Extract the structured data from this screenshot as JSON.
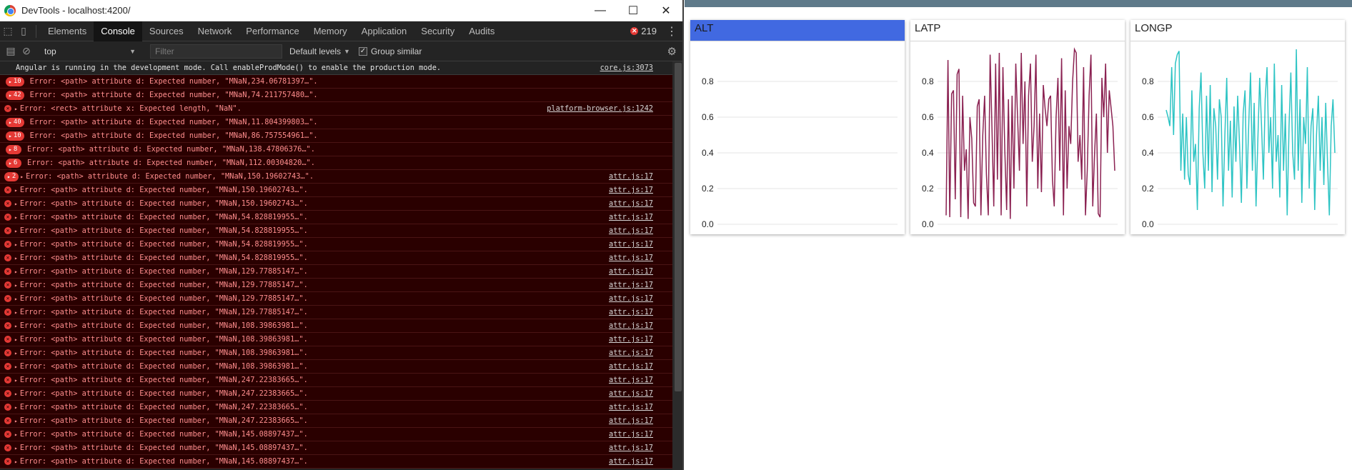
{
  "window": {
    "title": "DevTools - localhost:4200/"
  },
  "tabs": [
    "Elements",
    "Console",
    "Sources",
    "Network",
    "Performance",
    "Memory",
    "Application",
    "Security",
    "Audits"
  ],
  "active_tab": "Console",
  "error_count": "219",
  "toolbar": {
    "context": "top",
    "filter_placeholder": "Filter",
    "levels": "Default levels",
    "group_similar": "Group similar"
  },
  "console": [
    {
      "kind": "info",
      "text": "Angular is running in the development mode. Call enableProdMode() to enable the production mode.",
      "src": "core.js:3073"
    },
    {
      "kind": "badge",
      "count": "10",
      "text": "Error: <path> attribute d: Expected number, \"MNaN,234.06781397…\".",
      "src": ""
    },
    {
      "kind": "badge",
      "count": "42",
      "text": "Error: <path> attribute d: Expected number, \"MNaN,74.211757480…\".",
      "src": ""
    },
    {
      "kind": "error",
      "text": "Error: <rect> attribute x: Expected length, \"NaN\".",
      "src": "platform-browser.js:1242"
    },
    {
      "kind": "badge",
      "count": "40",
      "text": "Error: <path> attribute d: Expected number, \"MNaN,11.804399803…\".",
      "src": ""
    },
    {
      "kind": "badge",
      "count": "10",
      "text": "Error: <path> attribute d: Expected number, \"MNaN,86.757554961…\".",
      "src": ""
    },
    {
      "kind": "badge",
      "count": "8",
      "text": "Error: <path> attribute d: Expected number, \"MNaN,138.47806376…\".",
      "src": ""
    },
    {
      "kind": "badge",
      "count": "6",
      "text": "Error: <path> attribute d: Expected number, \"MNaN,112.00304820…\".",
      "src": ""
    },
    {
      "kind": "badge-small",
      "count": "2",
      "text": "Error: <path> attribute d: Expected number, \"MNaN,150.19602743…\".",
      "src": "attr.js:17"
    },
    {
      "kind": "error",
      "text": "Error: <path> attribute d: Expected number, \"MNaN,150.19602743…\".",
      "src": "attr.js:17"
    },
    {
      "kind": "error",
      "text": "Error: <path> attribute d: Expected number, \"MNaN,150.19602743…\".",
      "src": "attr.js:17"
    },
    {
      "kind": "error",
      "text": "Error: <path> attribute d: Expected number, \"MNaN,54.828819955…\".",
      "src": "attr.js:17"
    },
    {
      "kind": "error",
      "text": "Error: <path> attribute d: Expected number, \"MNaN,54.828819955…\".",
      "src": "attr.js:17"
    },
    {
      "kind": "error",
      "text": "Error: <path> attribute d: Expected number, \"MNaN,54.828819955…\".",
      "src": "attr.js:17"
    },
    {
      "kind": "error",
      "text": "Error: <path> attribute d: Expected number, \"MNaN,54.828819955…\".",
      "src": "attr.js:17"
    },
    {
      "kind": "error",
      "text": "Error: <path> attribute d: Expected number, \"MNaN,129.77885147…\".",
      "src": "attr.js:17"
    },
    {
      "kind": "error",
      "text": "Error: <path> attribute d: Expected number, \"MNaN,129.77885147…\".",
      "src": "attr.js:17"
    },
    {
      "kind": "error",
      "text": "Error: <path> attribute d: Expected number, \"MNaN,129.77885147…\".",
      "src": "attr.js:17"
    },
    {
      "kind": "error",
      "text": "Error: <path> attribute d: Expected number, \"MNaN,129.77885147…\".",
      "src": "attr.js:17"
    },
    {
      "kind": "error",
      "text": "Error: <path> attribute d: Expected number, \"MNaN,108.39863981…\".",
      "src": "attr.js:17"
    },
    {
      "kind": "error",
      "text": "Error: <path> attribute d: Expected number, \"MNaN,108.39863981…\".",
      "src": "attr.js:17"
    },
    {
      "kind": "error",
      "text": "Error: <path> attribute d: Expected number, \"MNaN,108.39863981…\".",
      "src": "attr.js:17"
    },
    {
      "kind": "error",
      "text": "Error: <path> attribute d: Expected number, \"MNaN,108.39863981…\".",
      "src": "attr.js:17"
    },
    {
      "kind": "error",
      "text": "Error: <path> attribute d: Expected number, \"MNaN,247.22383665…\".",
      "src": "attr.js:17"
    },
    {
      "kind": "error",
      "text": "Error: <path> attribute d: Expected number, \"MNaN,247.22383665…\".",
      "src": "attr.js:17"
    },
    {
      "kind": "error",
      "text": "Error: <path> attribute d: Expected number, \"MNaN,247.22383665…\".",
      "src": "attr.js:17"
    },
    {
      "kind": "error",
      "text": "Error: <path> attribute d: Expected number, \"MNaN,247.22383665…\".",
      "src": "attr.js:17"
    },
    {
      "kind": "error",
      "text": "Error: <path> attribute d: Expected number, \"MNaN,145.08897437…\".",
      "src": "attr.js:17"
    },
    {
      "kind": "error",
      "text": "Error: <path> attribute d: Expected number, \"MNaN,145.08897437…\".",
      "src": "attr.js:17"
    },
    {
      "kind": "error",
      "text": "Error: <path> attribute d: Expected number, \"MNaN,145.08897437…\".",
      "src": "attr.js:17"
    }
  ],
  "chart_data": [
    {
      "type": "line",
      "title": "ALT",
      "color": "#4169e1",
      "ylim": [
        0,
        1
      ],
      "yticks": [
        "0.0",
        "0.2",
        "0.4",
        "0.6",
        "0.8"
      ],
      "values": []
    },
    {
      "type": "line",
      "title": "LATP",
      "color": "#8b2252",
      "ylim": [
        0,
        1
      ],
      "yticks": [
        "0.0",
        "0.2",
        "0.4",
        "0.6",
        "0.8"
      ],
      "values": [
        0.05,
        0.92,
        0.04,
        0.73,
        0.75,
        0.14,
        0.84,
        0.87,
        0.04,
        0.72,
        0.3,
        0.42,
        0.03,
        0.6,
        0.48,
        0.12,
        0.1,
        0.66,
        0.7,
        0.05,
        0.5,
        0.72,
        0.28,
        0.05,
        0.95,
        0.55,
        0.1,
        0.9,
        0.25,
        0.96,
        0.05,
        0.88,
        0.42,
        0.08,
        0.7,
        0.03,
        0.72,
        0.2,
        0.9,
        0.6,
        0.3,
        0.96,
        0.45,
        0.8,
        0.1,
        0.72,
        0.9,
        0.35,
        0.55,
        0.95,
        0.2,
        0.62,
        0.18,
        0.78,
        0.65,
        0.55,
        0.7,
        0.72,
        0.25,
        0.1,
        0.6,
        0.82,
        0.3,
        0.93,
        0.05,
        0.75,
        0.2,
        0.55,
        0.45,
        0.8,
        0.98,
        0.96,
        0.35,
        0.5,
        0.25,
        0.88,
        0.05,
        0.3,
        0.72,
        0.95,
        0.1,
        0.4,
        0.62,
        0.06,
        0.04,
        0.82,
        0.6,
        0.9,
        0.4,
        0.75,
        0.65,
        0.55,
        0.3
      ]
    },
    {
      "type": "line",
      "title": "LONGP",
      "color": "#2ec4c4",
      "ylim": [
        0,
        1
      ],
      "yticks": [
        "0.0",
        "0.2",
        "0.4",
        "0.6",
        "0.8"
      ],
      "values": [
        0.64,
        0.6,
        0.55,
        0.88,
        0.5,
        0.9,
        0.95,
        0.97,
        0.3,
        0.62,
        0.25,
        0.6,
        0.28,
        0.22,
        0.75,
        0.35,
        0.45,
        0.08,
        0.65,
        0.85,
        0.4,
        0.2,
        0.72,
        0.3,
        0.78,
        0.18,
        0.65,
        0.55,
        0.25,
        0.7,
        0.6,
        0.1,
        0.5,
        0.82,
        0.3,
        0.58,
        0.15,
        0.66,
        0.35,
        0.72,
        0.45,
        0.12,
        0.62,
        0.75,
        0.2,
        0.55,
        0.85,
        0.3,
        0.68,
        0.1,
        0.48,
        0.82,
        0.55,
        0.25,
        0.7,
        0.88,
        0.4,
        0.6,
        0.2,
        0.9,
        0.35,
        0.5,
        0.15,
        0.78,
        0.3,
        0.62,
        0.05,
        0.55,
        0.85,
        0.4,
        0.25,
        0.98,
        0.3,
        0.7,
        0.12,
        0.6,
        0.45,
        0.88,
        0.2,
        0.55,
        0.65,
        0.08,
        0.5,
        0.72,
        0.3,
        0.6,
        0.22,
        0.68,
        0.35,
        0.05,
        0.55,
        0.7,
        0.4
      ]
    }
  ]
}
